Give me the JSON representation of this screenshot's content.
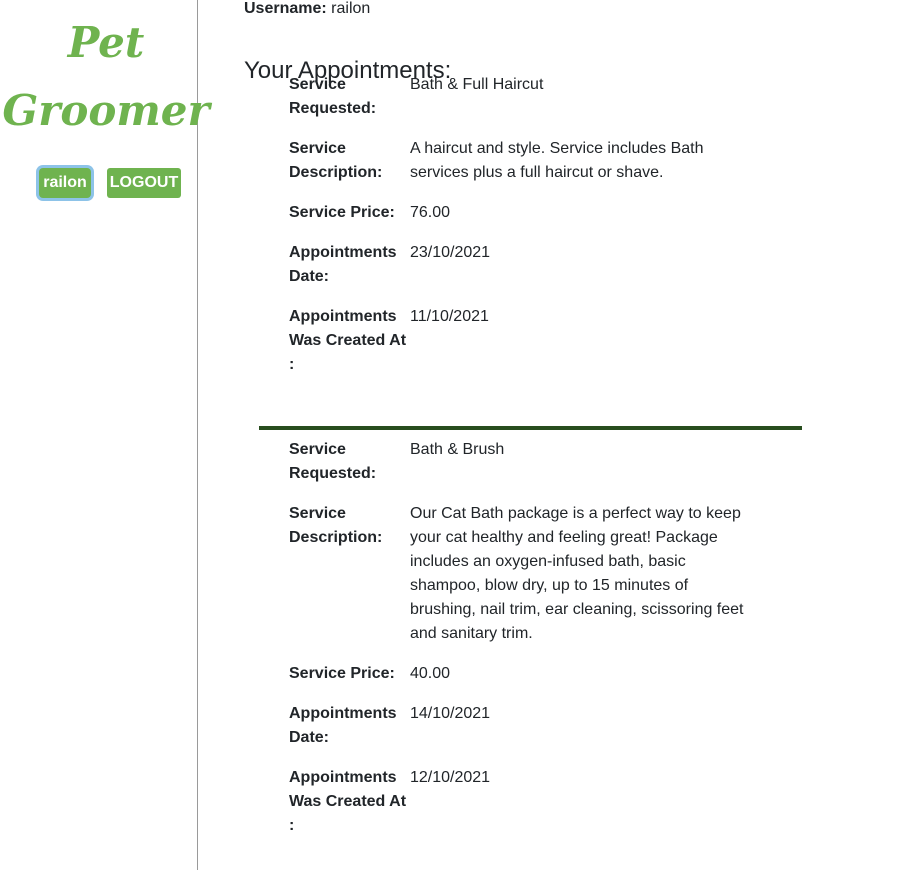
{
  "brand": {
    "line1": "Pet",
    "line2": "Groomer",
    "color": "#6fb34f"
  },
  "nav": {
    "user_button": "railon",
    "logout_button": "LOGOUT"
  },
  "profile": {
    "username_label": "Username:",
    "username_value": "railon"
  },
  "section_title": "Your Appointments:",
  "appointments": [
    {
      "service_requested_label": "Service Requested:",
      "service_requested": "Bath & Full Haircut",
      "service_description_label": "Service Description:",
      "service_description": "A haircut and style. Service includes Bath services plus a full haircut or shave.",
      "service_price_label": "Service Price:",
      "service_price": "76.00",
      "appointment_date_label": "Appointments Date:",
      "appointment_date": "23/10/2021",
      "created_at_label": "Appointments Was Created At :",
      "created_at": "11/10/2021"
    },
    {
      "service_requested_label": "Service Requested:",
      "service_requested": "Bath & Brush",
      "service_description_label": "Service Description:",
      "service_description": "Our Cat Bath package is a perfect way to keep your cat healthy and feeling great! Package includes an oxygen-infused bath, basic shampoo, blow dry, up to 15 minutes of brushing, nail trim, ear cleaning, scissoring feet and sanitary trim.",
      "service_price_label": "Service Price:",
      "service_price": "40.00",
      "appointment_date_label": "Appointments Date:",
      "appointment_date": "14/10/2021",
      "created_at_label": "Appointments Was Created At :",
      "created_at": "12/10/2021"
    }
  ]
}
